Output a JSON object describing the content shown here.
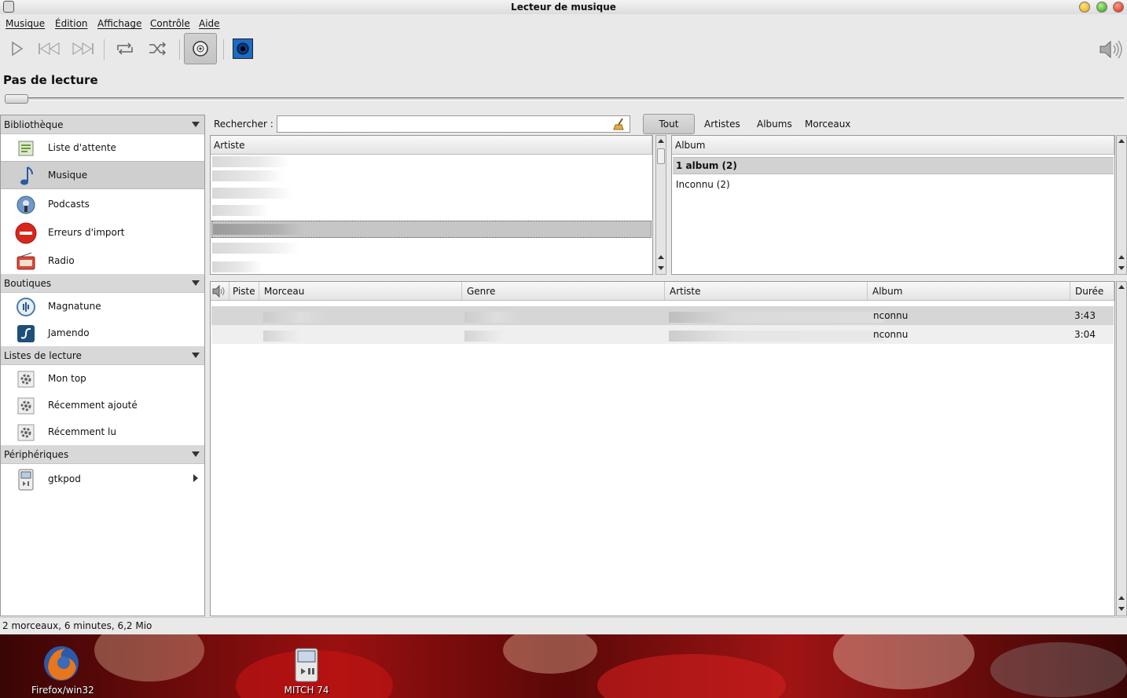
{
  "window": {
    "title": "Lecteur de musique"
  },
  "menubar": {
    "items": [
      "Musique",
      "Édition",
      "Affichage",
      "Contrôle",
      "Aide"
    ]
  },
  "toolbar": {
    "buttons": [
      "play-icon",
      "previous-icon",
      "next-icon",
      "repeat-icon",
      "shuffle-icon",
      "browse-icon",
      "visualization-icon",
      "volume-icon"
    ]
  },
  "now_playing": {
    "status": "Pas de lecture",
    "seek_fraction": 0
  },
  "sidebar": {
    "sections": [
      {
        "title": "Bibliothèque",
        "items": [
          "Liste d'attente",
          "Musique",
          "Podcasts",
          "Erreurs d'import",
          "Radio"
        ]
      },
      {
        "title": "Boutiques",
        "items": [
          "Magnatune",
          "Jamendo"
        ]
      },
      {
        "title": "Listes de lecture",
        "items": [
          "Mon top",
          "Récemment ajouté",
          "Récemment lu"
        ]
      },
      {
        "title": "Périphériques",
        "items": [
          "gtkpod"
        ]
      }
    ],
    "selected": "Musique"
  },
  "search": {
    "label": "Rechercher :",
    "value": "",
    "filters": [
      "Tout",
      "Artistes",
      "Albums",
      "Morceaux"
    ],
    "active_filter": "Tout"
  },
  "artist_pane": {
    "header": "Artiste"
  },
  "album_pane": {
    "header": "Album",
    "all_row": "1 album (2)",
    "rows": [
      "Inconnu (2)"
    ]
  },
  "tracks": {
    "columns": [
      "Piste",
      "Morceau",
      "Genre",
      "Artiste",
      "Album",
      "Durée"
    ],
    "rows": [
      {
        "album": "nconnu",
        "duration": "3:43"
      },
      {
        "album": "nconnu",
        "duration": "3:04"
      }
    ]
  },
  "statusbar": {
    "text": "2 morceaux, 6 minutes, 6,2 Mio"
  },
  "desktop": {
    "icons": [
      "Firefox/win32",
      "MITCH 74"
    ]
  },
  "colors": {
    "selection": "#cfcfcf",
    "window_bg": "#e9e9e9",
    "desktop_red": "#9a1010"
  }
}
